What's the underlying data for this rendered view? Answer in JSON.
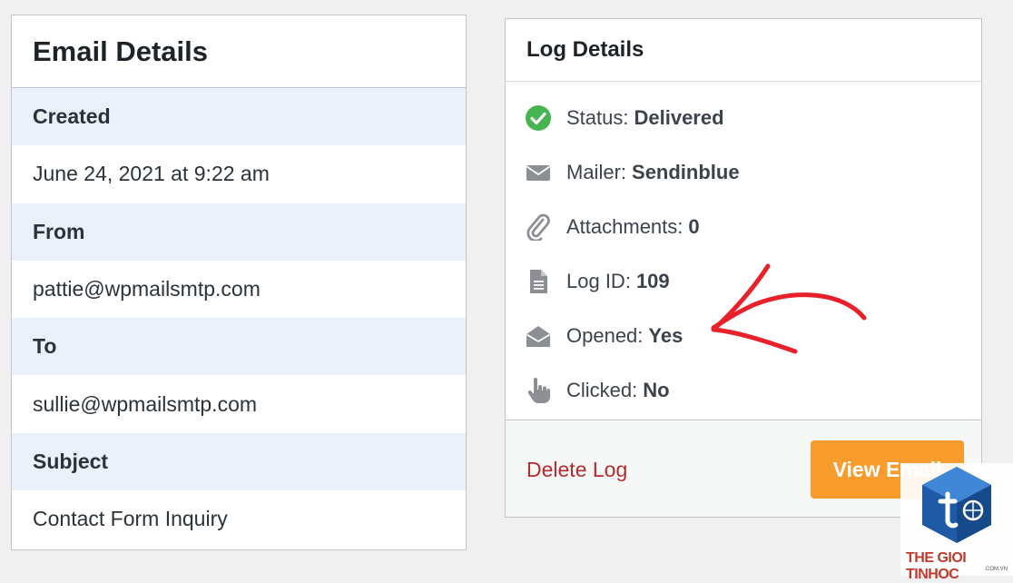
{
  "email_details": {
    "title": "Email Details",
    "rows": [
      {
        "label": "Created",
        "value": "June 24, 2021 at 9:22 am"
      },
      {
        "label": "From",
        "value": "pattie@wpmailsmtp.com"
      },
      {
        "label": "To",
        "value": "sullie@wpmailsmtp.com"
      },
      {
        "label": "Subject",
        "value": "Contact Form Inquiry"
      }
    ]
  },
  "log_details": {
    "title": "Log Details",
    "items": [
      {
        "label": "Status:",
        "value": "Delivered",
        "icon": "check-circle-icon"
      },
      {
        "label": "Mailer:",
        "value": "Sendinblue",
        "icon": "envelope-icon"
      },
      {
        "label": "Attachments:",
        "value": "0",
        "icon": "paperclip-icon"
      },
      {
        "label": "Log ID:",
        "value": "109",
        "icon": "document-icon"
      },
      {
        "label": "Opened:",
        "value": "Yes",
        "icon": "envelope-open-icon"
      },
      {
        "label": "Clicked:",
        "value": "No",
        "icon": "pointer-hand-icon"
      }
    ],
    "delete_label": "Delete Log",
    "view_label": "View Email"
  },
  "colors": {
    "success": "#46b450",
    "danger": "#b32d2e",
    "accent": "#f89c2e",
    "label_bg": "#eaf1fa",
    "annotation": "#e8202a"
  },
  "watermark": {
    "text": "THE GIOI TINHOC",
    "sub": ".COM.VN"
  }
}
